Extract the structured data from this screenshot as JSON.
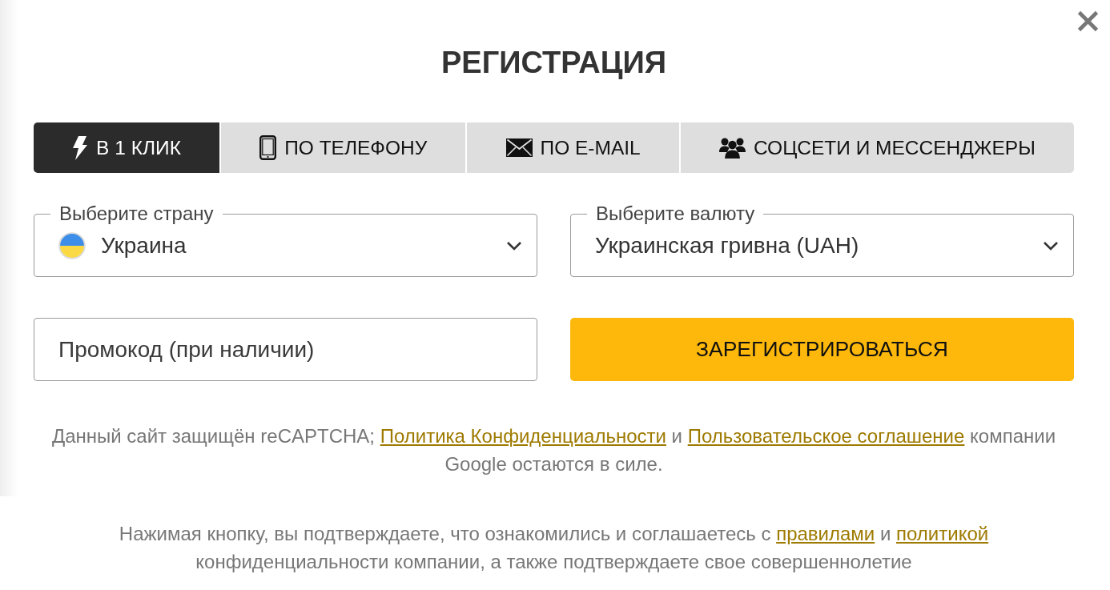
{
  "dialog": {
    "title": "РЕГИСТРАЦИЯ"
  },
  "tabs": [
    {
      "kind": "one_click",
      "label": "В 1 КЛИК",
      "selected": true
    },
    {
      "kind": "phone",
      "label": "ПО ТЕЛЕФОНУ",
      "selected": false
    },
    {
      "kind": "email",
      "label": "ПО E-MAIL",
      "selected": false
    },
    {
      "kind": "social",
      "label": "СОЦСЕТИ И МЕССЕНДЖЕРЫ",
      "selected": false
    }
  ],
  "selects": [
    {
      "kind": "country",
      "label": "Выберите страну",
      "value": "Украина"
    },
    {
      "kind": "currency",
      "label": "Выберите валюту",
      "value": "Украинская гривна (UAH)"
    }
  ],
  "promo_field": {
    "placeholder": "Промокод (при наличии)"
  },
  "register_button": {
    "label": "ЗАРЕГИСТРИРОВАТЬСЯ"
  },
  "notices": [
    {
      "kind": "recaptcha",
      "parts": [
        {
          "kind": "text",
          "text": "Данный сайт защищён reCAPTCHA; "
        },
        {
          "kind": "link",
          "text": "Политика Конфиденциальности"
        },
        {
          "kind": "text",
          "text": " и "
        },
        {
          "kind": "link",
          "text": "Пользовательское соглашение"
        },
        {
          "kind": "text",
          "text": " компании Google остаются в силе."
        }
      ]
    },
    {
      "kind": "consent",
      "parts": [
        {
          "kind": "text",
          "text": "Нажимая кнопку, вы подтверждаете, что ознакомились и соглашаетесь с "
        },
        {
          "kind": "link",
          "text": "правилами"
        },
        {
          "kind": "text",
          "text": " и "
        },
        {
          "kind": "link",
          "text": "политикой"
        },
        {
          "kind": "text",
          "text": " конфиденциальности компании, а также подтверждаете свое совершеннолетие"
        }
      ]
    }
  ]
}
